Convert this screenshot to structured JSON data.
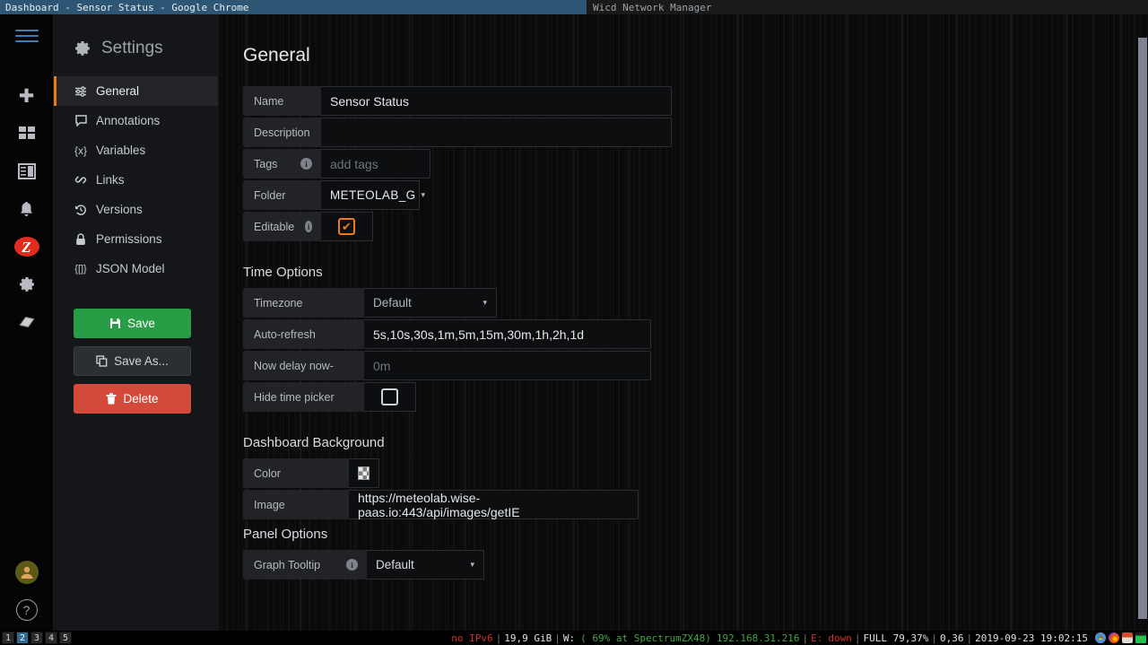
{
  "window_manager": {
    "active_window_title": "Dashboard - Sensor Status - Google Chrome",
    "inactive_window_title": "Wicd Network Manager"
  },
  "rail": {
    "items": [
      {
        "name": "menu-toggle",
        "icon": "hamburger-icon"
      },
      {
        "name": "create-new",
        "icon": "plus-icon",
        "glyph": "✚"
      },
      {
        "name": "dashboards",
        "icon": "dashboards-grid-icon",
        "glyph": "▣"
      },
      {
        "name": "panels",
        "icon": "panels-icon",
        "glyph": "▤"
      },
      {
        "name": "alerting",
        "icon": "bell-icon",
        "glyph": "🔔"
      },
      {
        "name": "zabbix",
        "icon": "z-logo-icon",
        "glyph": "Z"
      },
      {
        "name": "configuration",
        "icon": "gear-icon",
        "glyph": "⚙"
      },
      {
        "name": "docs",
        "icon": "book-icon",
        "glyph": "📖"
      }
    ],
    "bottom": [
      {
        "name": "user-avatar",
        "icon": "avatar-icon",
        "glyph": "👤"
      },
      {
        "name": "help",
        "icon": "question-mark-icon",
        "glyph": "?"
      }
    ]
  },
  "settings": {
    "title": "Settings",
    "title_icon": "gear-icon",
    "nav": [
      {
        "label": "General",
        "icon": "sliders-icon",
        "glyph": "☲",
        "active": true
      },
      {
        "label": "Annotations",
        "icon": "comment-icon",
        "glyph": "🗩",
        "active": false
      },
      {
        "label": "Variables",
        "icon": "braces-icon",
        "glyph": "{x}",
        "active": false
      },
      {
        "label": "Links",
        "icon": "link-icon",
        "glyph": "🔗",
        "active": false
      },
      {
        "label": "Versions",
        "icon": "history-icon",
        "glyph": "↺",
        "active": false
      },
      {
        "label": "Permissions",
        "icon": "lock-icon",
        "glyph": "🔒",
        "active": false
      },
      {
        "label": "JSON Model",
        "icon": "code-icon",
        "glyph": "{[]}",
        "active": false
      }
    ],
    "buttons": {
      "save": "Save",
      "save_icon": "floppy-disk-icon",
      "save_as": "Save As...",
      "save_as_icon": "copy-icon",
      "delete": "Delete",
      "delete_icon": "trash-icon"
    }
  },
  "general": {
    "heading": "General",
    "name_label": "Name",
    "name_value": "Sensor Status",
    "description_label": "Description",
    "description_value": "",
    "tags_label": "Tags",
    "tags_placeholder": "add tags",
    "folder_label": "Folder",
    "folder_value": "METEOLAB_G",
    "editable_label": "Editable",
    "editable_checked": true
  },
  "time_options": {
    "heading": "Time Options",
    "timezone_label": "Timezone",
    "timezone_value": "Default",
    "autorefresh_label": "Auto-refresh",
    "autorefresh_value": "5s,10s,30s,1m,5m,15m,30m,1h,2h,1d",
    "nowdelay_label": "Now delay now-",
    "nowdelay_placeholder": "0m",
    "hidetimepicker_label": "Hide time picker",
    "hidetimepicker_checked": false
  },
  "dashboard_background": {
    "heading": "Dashboard Background",
    "color_label": "Color",
    "color_value": "transparent",
    "image_label": "Image",
    "image_value": "https://meteolab.wise-paas.io:443/api/images/getIE"
  },
  "panel_options": {
    "heading": "Panel Options",
    "graph_tooltip_label": "Graph Tooltip",
    "graph_tooltip_value": "Default"
  },
  "taskbar": {
    "desktops": [
      "1",
      "2",
      "3",
      "4",
      "5"
    ],
    "selected_desktop": "2",
    "status": {
      "ipv6": "no IPv6",
      "memory": "19,9 GiB",
      "wifi_prefix": "W:",
      "wifi_detail": "( 69% at SpectrumZX48)",
      "ip": "192.168.31.216",
      "eth_prefix": "E:",
      "eth_state": "down",
      "battery": "FULL 79,37%",
      "load": "0,36",
      "datetime": "2019-09-23 19:02:15"
    },
    "tray": [
      "chrome-icon",
      "firefox-icon",
      "archive-icon",
      "terminal-icon"
    ]
  },
  "colors": {
    "accent_orange": "#eb7b18",
    "save_green": "#299c46",
    "delete_red": "#d44a3a",
    "zabbix_red": "#e02d20",
    "titlebar_blue": "#2d5674"
  }
}
